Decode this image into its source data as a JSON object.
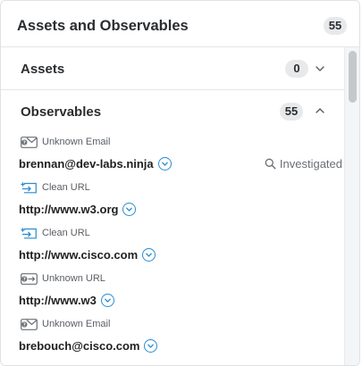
{
  "header": {
    "title": "Assets and Observables",
    "count": "55"
  },
  "assets": {
    "title": "Assets",
    "count": "0"
  },
  "observables": {
    "title": "Observables",
    "count": "55",
    "items": [
      {
        "type": "Unknown Email",
        "icon": "unknown-email-icon",
        "value": "brennan@dev-labs.ninja",
        "status": "Investigated"
      },
      {
        "type": "Clean URL",
        "icon": "clean-url-icon",
        "value": "http://www.w3.org"
      },
      {
        "type": "Clean URL",
        "icon": "clean-url-icon",
        "value": "http://www.cisco.com"
      },
      {
        "type": "Unknown URL",
        "icon": "unknown-url-icon",
        "value": "http://www.w3"
      },
      {
        "type": "Unknown Email",
        "icon": "unknown-email-icon",
        "value": "brebouch@cisco.com"
      }
    ]
  },
  "colors": {
    "accent": "#2a8cd0",
    "badge_bg": "#e8e9eb",
    "border": "#dfe1e4"
  }
}
